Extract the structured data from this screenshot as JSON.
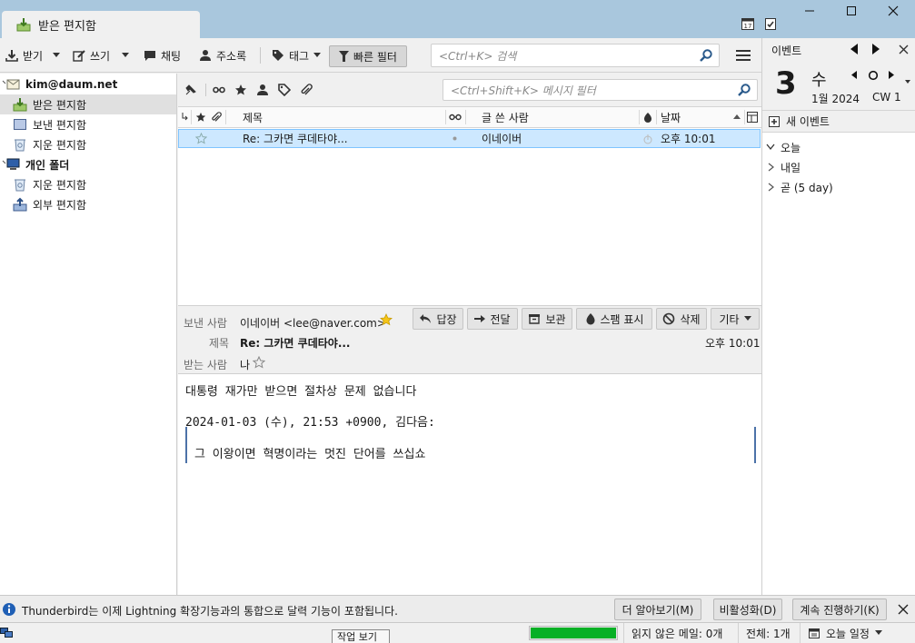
{
  "window": {
    "tab_title": "받은 편지함"
  },
  "toolbar": {
    "get_label": "받기",
    "write_label": "쓰기",
    "chat_label": "채팅",
    "addressbook_label": "주소록",
    "tag_label": "태그",
    "quickfilter_label": "빠른 필터",
    "search_placeholder": "<Ctrl+K> 검색"
  },
  "folders": {
    "account": "kim@daum.net",
    "inbox": "받은 편지함",
    "sent": "보낸 편지함",
    "trash": "지운 편지함",
    "local": "개인 폴더",
    "local_trash": "지운 편지함",
    "outbox": "외부 편지함"
  },
  "threadpane": {
    "filter_placeholder": "<Ctrl+Shift+K> 메시지 필터",
    "columns": {
      "subject": "제목",
      "author": "글 쓴 사람",
      "date": "날짜"
    },
    "messages": [
      {
        "subject": "Re: 그카면 쿠데타야...",
        "author": "이네이버",
        "date": "오후 10:01",
        "starred": false
      }
    ]
  },
  "message_header": {
    "from_label": "보낸 사람",
    "from_value": "이네이버 <lee@naver.com>",
    "subject_label": "제목",
    "subject_value": "Re: 그카면 쿠데타야...",
    "to_label": "받는 사람",
    "to_value": "나",
    "time": "오후 10:01",
    "buttons": {
      "reply": "답장",
      "forward": "전달",
      "archive": "보관",
      "junk": "스팸 표시",
      "delete": "삭제",
      "other": "기타"
    }
  },
  "message_body": {
    "line1": "대통령 재가만 받으면 절차상 문제 없습니다",
    "attribution": "2024-01-03 (수), 21:53 +0900, 김다음:",
    "quote": "그 이왕이면 혁명이라는 멋진 단어를 쓰십쇼"
  },
  "today_pane": {
    "title": "이벤트",
    "day_number": "3",
    "weekday": "수",
    "month_year": "1월 2024",
    "week": "CW 1",
    "new_event_label": "새 이벤트",
    "agenda": [
      {
        "label": "오늘",
        "expanded": true
      },
      {
        "label": "내일",
        "expanded": false
      },
      {
        "label": "곧 (5 day)",
        "expanded": false
      }
    ]
  },
  "notification": {
    "text": "Thunderbird는 이제 Lightning 확장기능과의 통합으로 달력 기능이 포함됩니다.",
    "learn_more": "더 알아보기(M)",
    "disable": "비활성화(D)",
    "keep": "계속 진행하기(K)"
  },
  "statusbar": {
    "unread": "읽지 않은 메일: 0개",
    "total": "전체: 1개",
    "today_pane_label": "오늘 일정",
    "tooltip": "작업 보기",
    "progress": 1.0
  },
  "colors": {
    "titlebar": "#a9c7dd",
    "selection": "#cde8ff",
    "selection_border": "#7fc4ff",
    "progress_green": "#06b025",
    "quote_bar": "#4c72a8"
  }
}
